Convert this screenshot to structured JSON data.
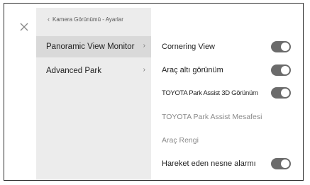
{
  "breadcrumb": {
    "back_icon": "chevron-left-icon",
    "text": "Kamera Görünümü - Ayarlar"
  },
  "sidebar": {
    "items": [
      {
        "label": "Panoramic View Monitor",
        "active": true,
        "arrow": "›"
      },
      {
        "label": "Advanced Park",
        "active": false,
        "arrow": "›"
      }
    ]
  },
  "settings": [
    {
      "label": "Cornering View",
      "toggle": true,
      "on": true
    },
    {
      "label": "Araç altı görünüm",
      "toggle": true,
      "on": true
    },
    {
      "label": "TOYOTA Park Assist 3D Görünüm",
      "toggle": true,
      "on": true
    },
    {
      "label": "TOYOTA Park Assist Mesafesi",
      "toggle": false,
      "disabled": true
    },
    {
      "label": "Araç Rengi",
      "toggle": false,
      "disabled": true
    },
    {
      "label": "Hareket eden nesne alarmı",
      "toggle": true,
      "on": true
    }
  ],
  "colors": {
    "toggle_on": "#6b6b6b",
    "sidebar_bg": "#ececec",
    "sidebar_active": "#d9d9d9"
  }
}
